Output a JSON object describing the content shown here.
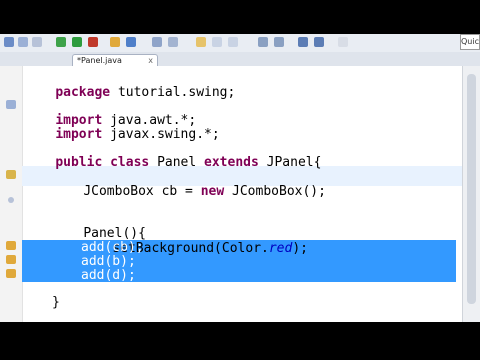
{
  "toolbar": {
    "quick_access_label": "Quic"
  },
  "editor": {
    "tab_title": "*Panel.java",
    "tab_close": "x",
    "lines": [
      {
        "text": "package tutorial.swing;"
      },
      {
        "text": "import java.awt.*;"
      },
      {
        "text": "import javax.swing.*;"
      },
      {
        "text": "public class Panel extends JPanel{"
      },
      {
        "text": "JComboBox cb = new JComboBox();"
      },
      {
        "text": "Panel(){"
      },
      {
        "text": "setBackground(Color.red);"
      },
      {
        "text": "add(cb);"
      },
      {
        "text": "add(b);"
      },
      {
        "text": "add(d);"
      },
      {
        "text": "}"
      }
    ]
  },
  "colors": {
    "keyword": "#7f0055",
    "selection": "#3399ff",
    "static_field": "#0000c0"
  }
}
